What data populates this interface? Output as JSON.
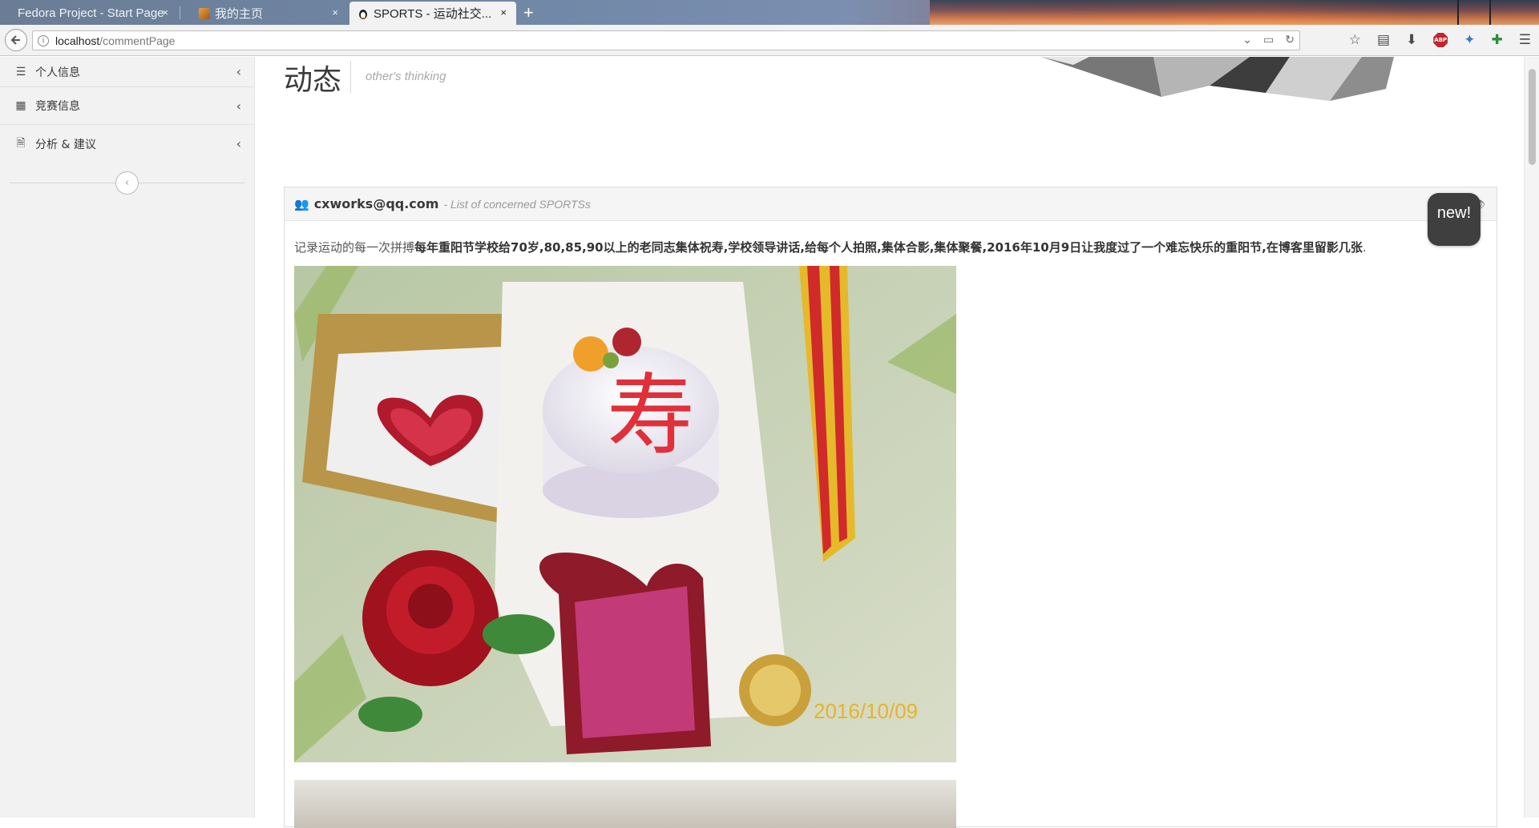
{
  "browser": {
    "tabs": [
      {
        "label": "Fedora Project - Start Page",
        "active": false
      },
      {
        "label": "我的主页",
        "active": false
      },
      {
        "label": "SPORTS - 运动社交...",
        "active": true
      }
    ],
    "close_glyph": "×",
    "new_tab_glyph": "+",
    "url_host": "localhost",
    "url_path": "/commentPage"
  },
  "sidebar": {
    "items": [
      {
        "label": "个人信息",
        "icon": "list-icon"
      },
      {
        "label": "竞赛信息",
        "icon": "grid-icon"
      },
      {
        "label": "分析 & 建议",
        "icon": "document-icon"
      }
    ],
    "collapse_glyph": "‹"
  },
  "header": {
    "title": "动态",
    "subtitle": "other's thinking"
  },
  "post": {
    "author": "cxworks@qq.com",
    "author_subtitle": "- List of concerned SPORTSs",
    "text_intro": "记录运动的每一次拼搏",
    "text_body": "每年重阳节学校给70岁,80,85,90以上的老同志集体祝寿,学校领导讲话,给每个人拍照,集体合影,集体聚餐,2016年10月9日让我度过了一个难忘快乐的重阳节,在博客里留影几张",
    "text_end": ".",
    "photo_date": "2016/10/09",
    "photo_char": "寿"
  },
  "notification": {
    "label": "new!"
  },
  "colors": {
    "sidebar_bg": "#f2f2f2",
    "panel_head_bg": "#f5f5f5",
    "bubble_bg": "#3f3f3f"
  }
}
